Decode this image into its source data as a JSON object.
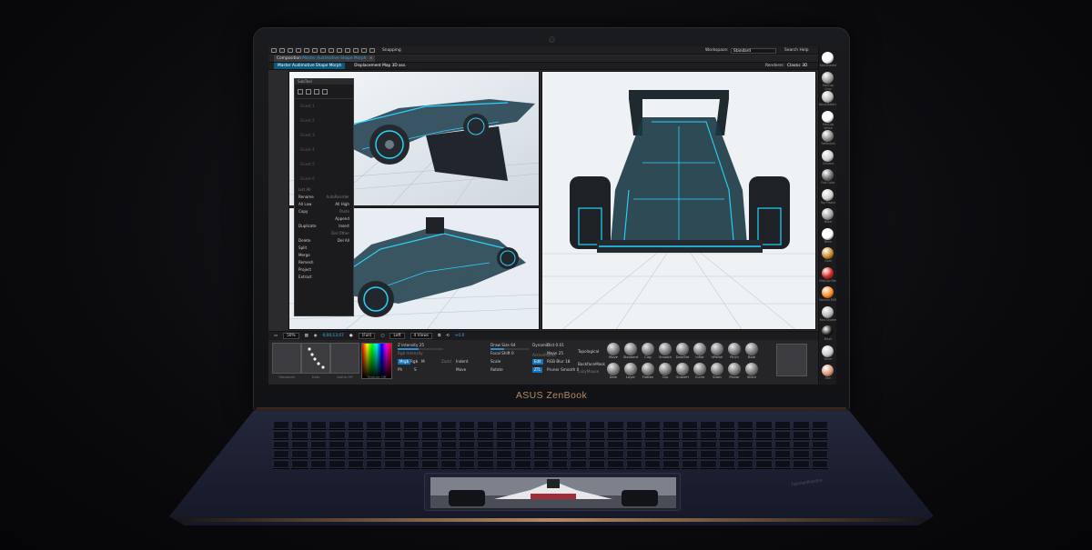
{
  "laptop": {
    "brand": "ASUS ZenBook",
    "keyboard_logo": "harman/kardon"
  },
  "topbar": {
    "snapping_label": "Snapping",
    "workspace_label": "Workspace:",
    "workspace_value": "Standard",
    "search_label": "Search Help"
  },
  "tabs": {
    "composition_label": "Composition",
    "composition_name": "Master Audimotive Shape Morph",
    "subtabs": [
      "Master Audimotive Shape Morph",
      "Displacement Map 3D ass."
    ],
    "renderer_label": "Renderer:",
    "renderer_value": "Classic 3D"
  },
  "palette": {
    "title": "SubTool",
    "ghost_items": [
      "Gvest 1",
      "Gvest 2",
      "Gvest 3",
      "Gvest 4",
      "Gvest 5",
      "Gvest 6"
    ],
    "list_all_label": "List All",
    "rows": [
      [
        "Rename",
        "AutoReorder"
      ],
      [
        "All Low",
        "All High"
      ],
      [
        "Copy",
        "Paste"
      ],
      [
        "",
        "Append"
      ],
      [
        "Duplicate",
        "Insert"
      ],
      [
        "",
        "Del Other"
      ],
      [
        "Delete",
        "Del All"
      ],
      [
        "Split",
        ""
      ],
      [
        "Merge",
        ""
      ],
      [
        "Remesh",
        ""
      ],
      [
        "Project",
        ""
      ],
      [
        "Extract",
        ""
      ]
    ]
  },
  "midbar": {
    "zoom": "50%",
    "timecode": "0;00;13;07",
    "resolution": "(Full)",
    "view": "Left",
    "views": "4 Views",
    "offset": "+0.0"
  },
  "bottompanel": {
    "thumb_labels": [
      "Standard",
      "Dots",
      "Alpha Off",
      "Texture Off"
    ],
    "controls": {
      "intensity": "Z Intensity 25",
      "rgb_intensity": "Rgb Intensity",
      "mrgb": "Mrgb",
      "rgb": "Rgb",
      "m": "M",
      "zadd": "Zadd",
      "zsub": "Zsub",
      "zcut": "Zcut",
      "focal_shift": "Focal Shift 0",
      "draw_size": "Draw Size 64",
      "dynamic": "Dynamic",
      "activepoints": "ActivePoints",
      "totalpoints": "TotalPoints",
      "lazymouse": "LazyMouse",
      "backfacemask": "BackfaceMask",
      "ztl": "ZTL",
      "ph": "Ph",
      "s": "S",
      "indent": "Indent",
      "edit": "Edit",
      "move": "Move",
      "scale": "Scale",
      "rotate": "Rotate",
      "dist": "Dist 0.01",
      "mean": "Mean 25",
      "topological": "Topological",
      "rgb_blur": "RGB Blur 18",
      "pruner": "Pruner Smooth 0"
    },
    "brushes": [
      "Move",
      "Standard",
      "Clay",
      "Smooth",
      "DamStd",
      "Inflat",
      "hPolish",
      "Pinch",
      "Blob",
      "Dam",
      "Layer",
      "Flatten",
      "Clip",
      "SnakeH",
      "Curve",
      "Slash",
      "Planar",
      "Stitch"
    ]
  },
  "shelf": {
    "materials": [
      "SkinShade4",
      "MatCap Gray",
      "BasicMaterial",
      "MatCap White",
      "Reflected",
      "Chrome",
      "Flat Color",
      "Toy Plastic",
      "Metal",
      "Blinn",
      "Gold",
      "MatCap Red",
      "Normal RGB",
      "Fast Shader",
      "Black",
      "Silver",
      "Skin"
    ]
  }
}
